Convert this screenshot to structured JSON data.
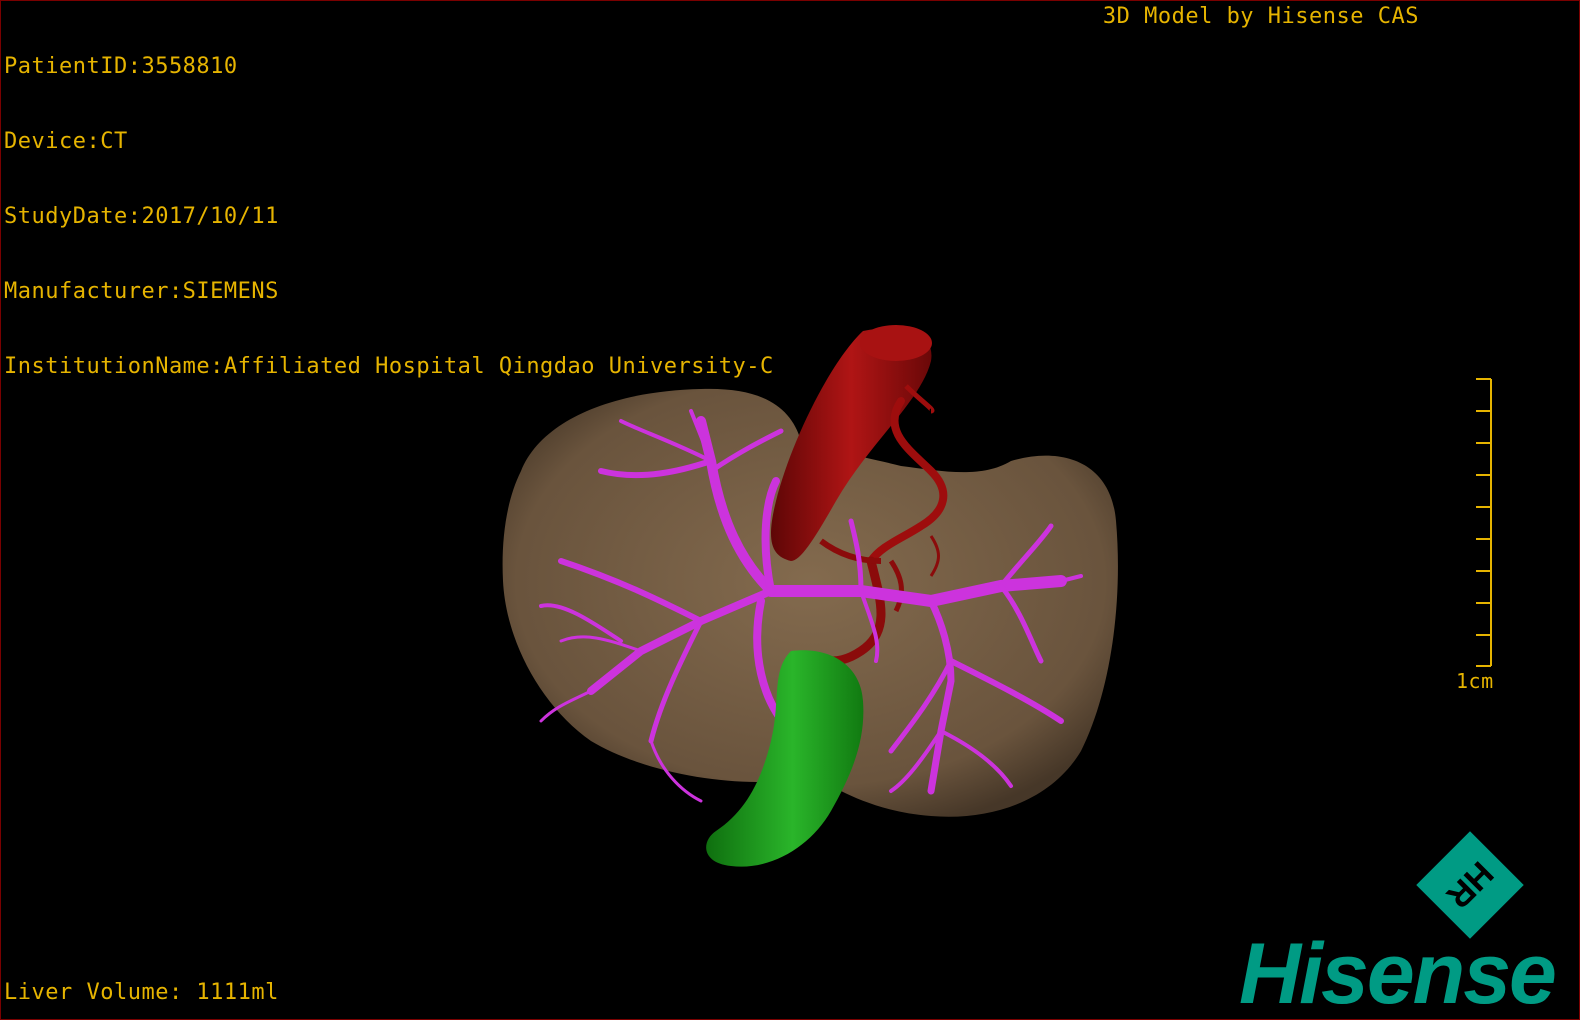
{
  "overlay": {
    "patient_id": "PatientID:3558810",
    "device": "Device:CT",
    "study_date": "StudyDate:2017/10/11",
    "manufacturer": "Manufacturer:SIEMENS",
    "institution": "InstitutionName:Affiliated Hospital Qingdao University-C",
    "credit": "3D Model by Hisense CAS",
    "liver_volume": "Liver Volume: 1111ml"
  },
  "scale_bar": {
    "label": "1cm"
  },
  "branding": {
    "logo_text": "Hisense",
    "badge_text": "HR"
  },
  "colors": {
    "overlay_text": "#e6b400",
    "liver": "#7a6248",
    "vessel_magenta": "#cc33dd",
    "artery_red": "#9e0d0d",
    "gallbladder_green": "#1fa11f",
    "brand_teal": "#009b84",
    "frame": "#7a0000"
  }
}
